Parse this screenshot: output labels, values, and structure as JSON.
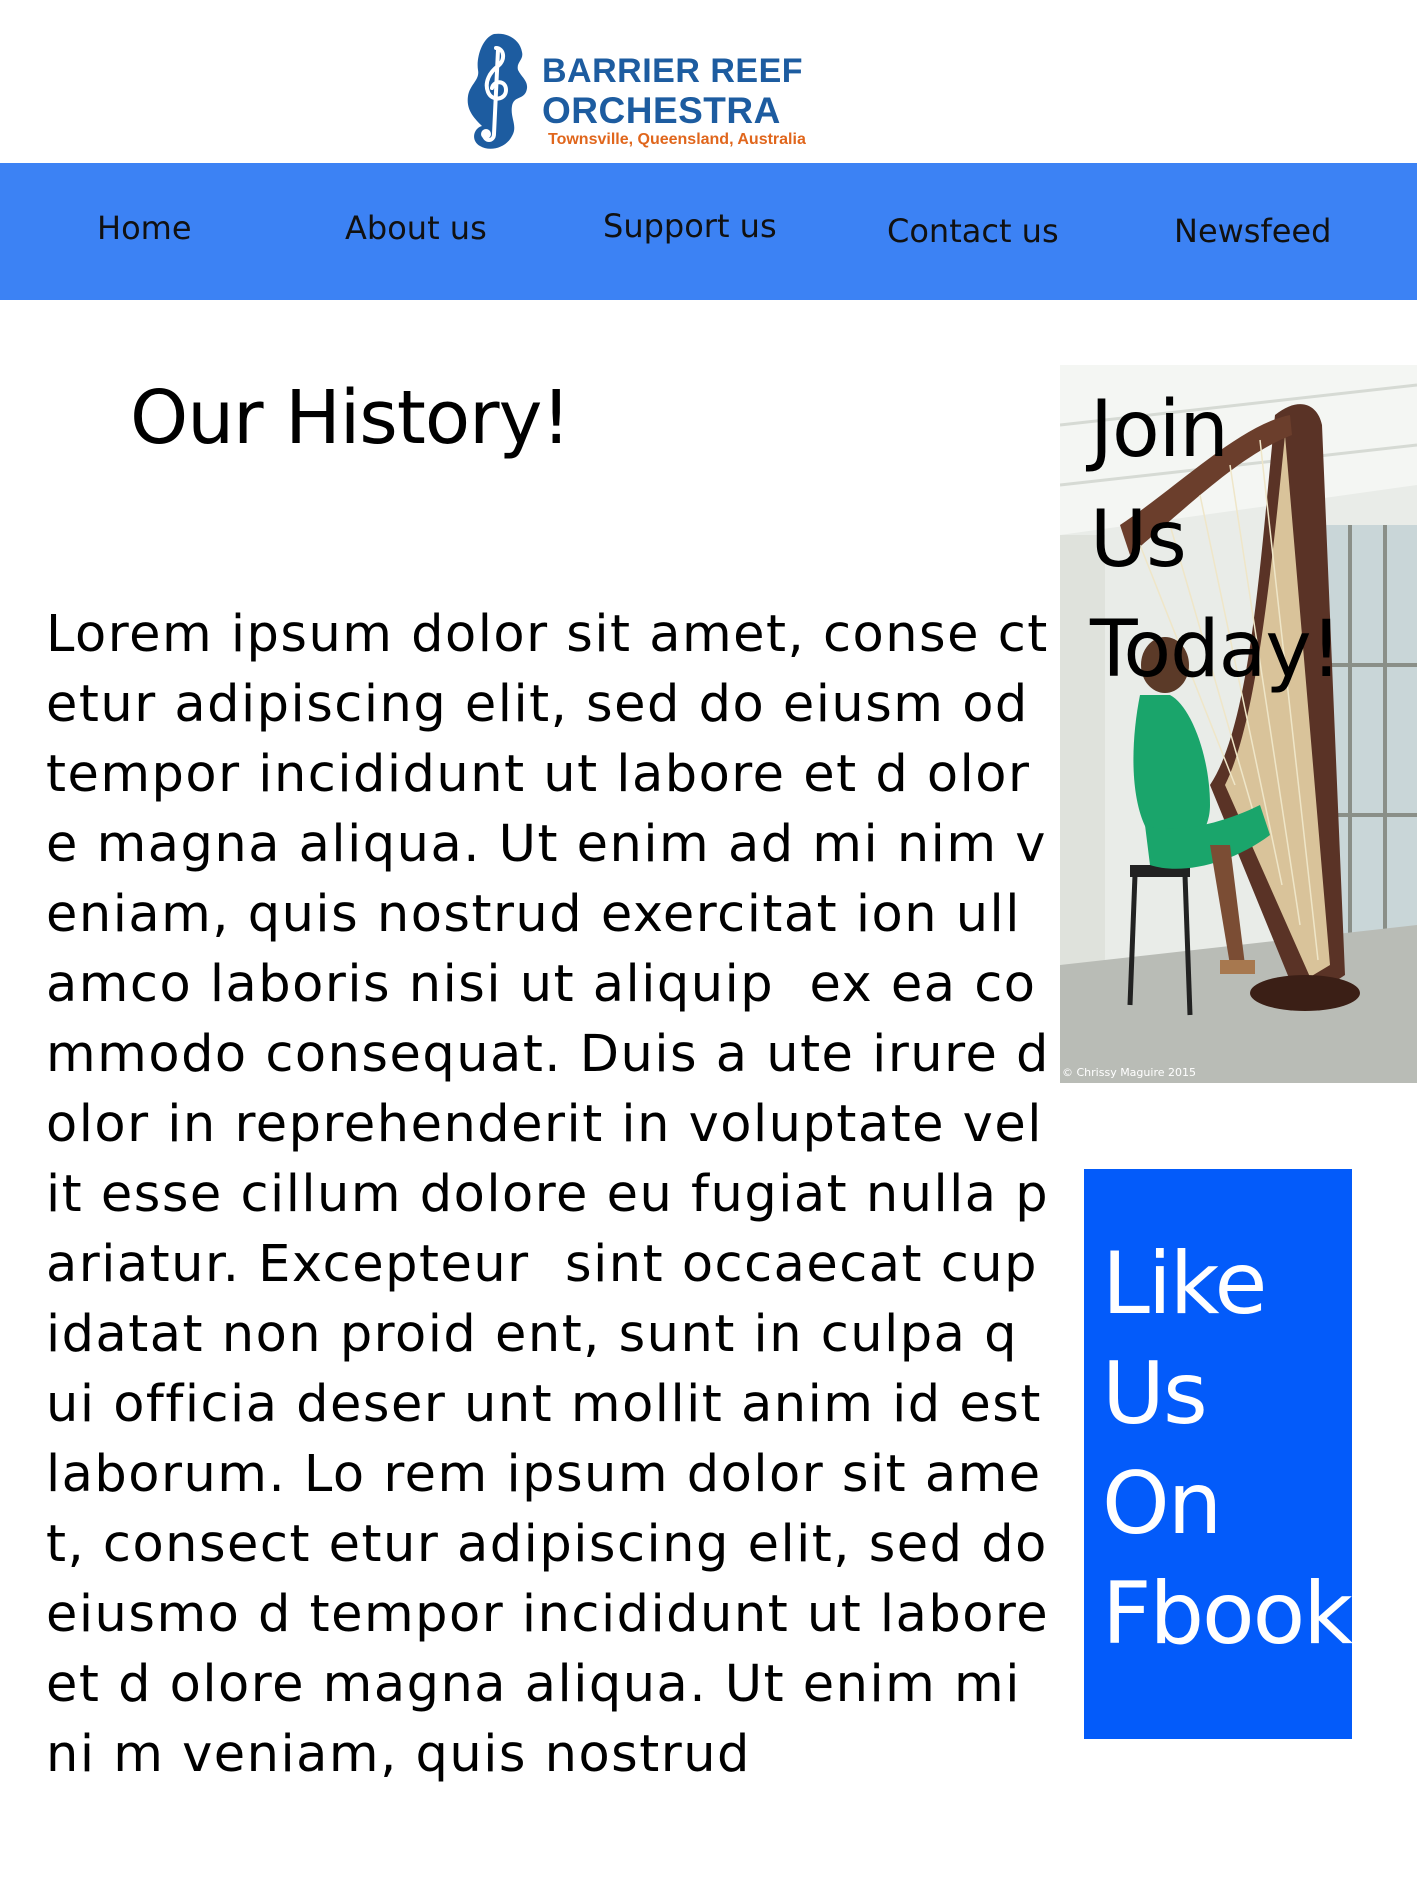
{
  "header": {
    "logo_line1": "BARRIER REEF",
    "logo_line2": "ORCHESTRA",
    "logo_subtitle": "Townsville, Queensland, Australia",
    "logo_icon": "treble-clef-seahorse-icon"
  },
  "nav": {
    "items": [
      {
        "label": "Home"
      },
      {
        "label": "About us"
      },
      {
        "label": "Support us"
      },
      {
        "label": "Contact us"
      },
      {
        "label": "Newsfeed"
      }
    ]
  },
  "main": {
    "title": "Our History!",
    "body": "Lorem ipsum dolor sit amet, conse ctetur adipiscing elit, sed do eiusm od tempor incididunt ut labore et d olore magna aliqua. Ut enim ad mi nim veniam, quis nostrud exercitat ion ullamco laboris nisi ut aliquip  ex ea commodo consequat. Duis a ute irure dolor in reprehenderit in voluptate velit esse cillum dolore eu fugiat nulla pariatur. Excepteur  sint occaecat cupidatat non proid ent, sunt in culpa qui officia deser unt mollit anim id est laborum. Lo rem ipsum dolor sit amet, consect etur adipiscing elit, sed do eiusmo d tempor incididunt ut labore et d olore magna aliqua. Ut enim mini m veniam, quis nostrud"
  },
  "sidebar": {
    "join_text": "Join\nUs\nToday!",
    "photo_credit": "© Chrissy Maguire 2015",
    "facebook_text": "Like\nUs\nOn\nFbook"
  },
  "colors": {
    "nav_bg": "#3c82f4",
    "facebook_bg": "#035bfa",
    "logo_blue": "#1d5ca0",
    "logo_orange": "#e0661c"
  }
}
